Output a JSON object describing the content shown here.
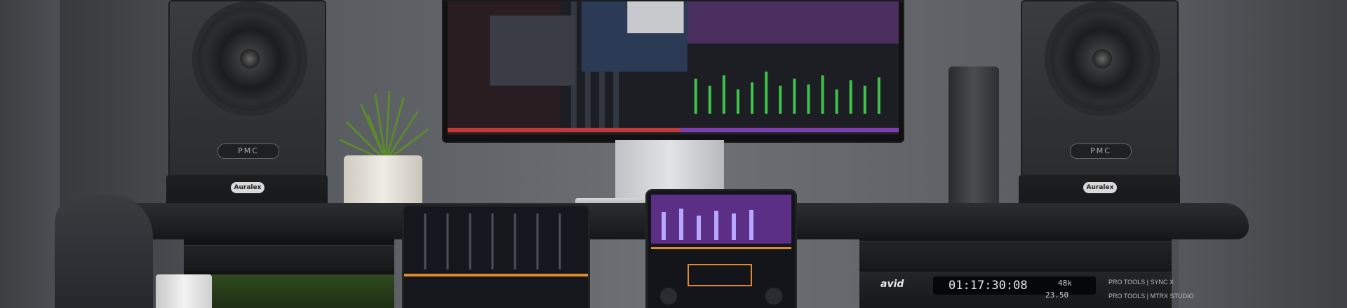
{
  "scene": {
    "speaker_brand": "PMC",
    "stand_brand": "Auralex",
    "audio_interface": {
      "brand": "avid",
      "timecode": "01:17:30:08",
      "sample_rate": "48k",
      "extra_value": "23.50"
    },
    "rack_labels": [
      "PRO TOOLS | SYNC X",
      "PRO TOOLS | MTRX STUDIO"
    ],
    "colors": {
      "wall": "#6e7175",
      "desk": "#1b1c1f",
      "screen_accent_purple": "#7a3fb0",
      "screen_accent_red": "#c23b3b",
      "screen_accent_green": "#3ec24a",
      "tower_led": "#2e7cff"
    }
  }
}
